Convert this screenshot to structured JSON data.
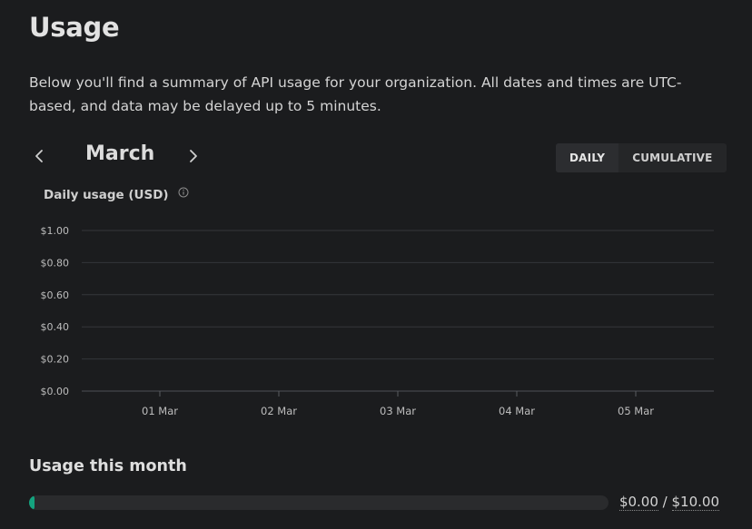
{
  "page": {
    "title": "Usage",
    "description": "Below you'll find a summary of API usage for your organization. All dates and times are UTC-based, and data may be delayed up to 5 minutes."
  },
  "nav": {
    "month": "March",
    "prev_icon": "chevron-left-icon",
    "next_icon": "chevron-right-icon",
    "toggle": {
      "daily": "DAILY",
      "cumulative": "CUMULATIVE",
      "selected": "DAILY"
    }
  },
  "chart_header": {
    "label": "Daily usage (USD)",
    "info_icon": "info-icon"
  },
  "chart_data": {
    "type": "bar",
    "title": "Daily usage (USD)",
    "categories": [
      "01 Mar",
      "02 Mar",
      "03 Mar",
      "04 Mar",
      "05 Mar"
    ],
    "values": [
      0,
      0,
      0,
      0,
      0
    ],
    "y_ticks": [
      "$0.00",
      "$0.20",
      "$0.40",
      "$0.60",
      "$0.80",
      "$1.00"
    ],
    "ylim": [
      0,
      1
    ],
    "grid": true
  },
  "month_usage": {
    "title": "Usage this month",
    "used": "$0.00",
    "separator": " / ",
    "limit": "$10.00",
    "fraction": 0
  },
  "colors": {
    "background": "#1b1c1e",
    "accent": "#14a37f",
    "grid": "#34363a"
  }
}
